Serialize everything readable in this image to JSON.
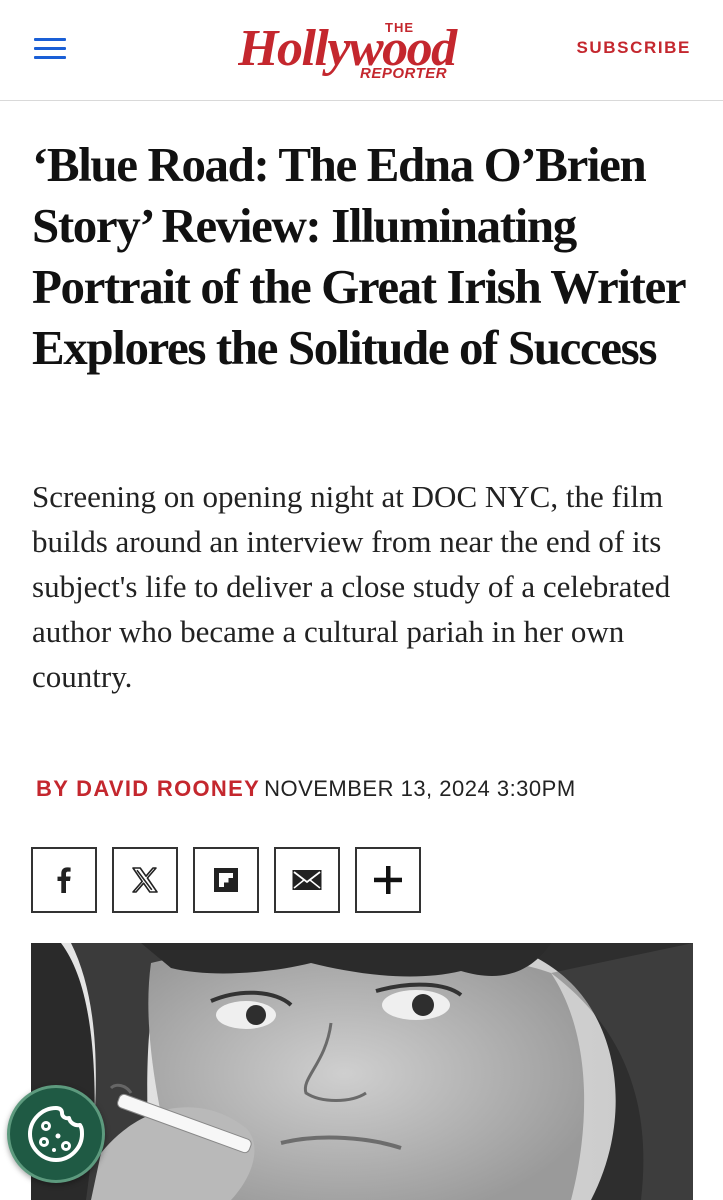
{
  "header": {
    "menu_icon": "hamburger-menu-icon",
    "logo": {
      "top": "THE",
      "main": "Hollywood",
      "bottom": "REPORTER"
    },
    "subscribe_label": "SUBSCRIBE",
    "colors": {
      "brand_red": "#c4272e",
      "menu_blue": "#1a5fd6"
    }
  },
  "article": {
    "headline": "‘Blue Road: The Edna O’Brien Story’ Review: Illuminating Portrait of the Great Irish Writer Explores the Solitude of Success",
    "dek": "Screening on opening night at DOC NYC, the film builds around an interview from near the end of its subject's life to deliver a close study of a celebrated author who became a cultural pariah in her own country.",
    "byline": {
      "author": "By David Rooney",
      "date": "NOVEMBER 13, 2024 3:30PM"
    }
  },
  "share": [
    {
      "icon": "facebook-icon"
    },
    {
      "icon": "x-twitter-icon"
    },
    {
      "icon": "flipboard-icon"
    },
    {
      "icon": "email-icon"
    },
    {
      "icon": "plus-icon"
    }
  ],
  "photo": {
    "icon": "lead-photo"
  },
  "cookie": {
    "icon": "cookie-icon",
    "color": "#1f5a44"
  }
}
